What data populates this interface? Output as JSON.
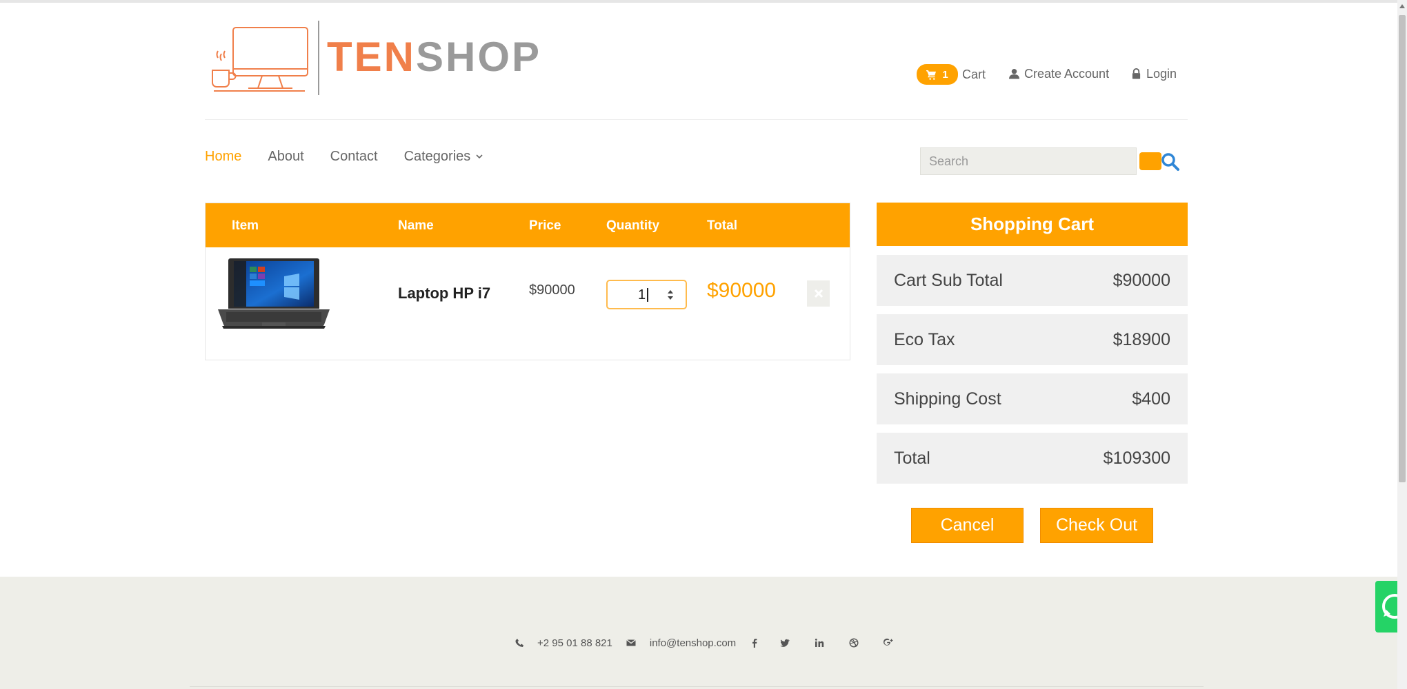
{
  "brand": {
    "part1": "TEN",
    "part2": "SHOP"
  },
  "header": {
    "cart_count": "1",
    "cart_label": "Cart",
    "create_account_label": "Create Account",
    "login_label": "Login"
  },
  "nav": {
    "items": [
      {
        "label": "Home",
        "active": true
      },
      {
        "label": "About",
        "active": false
      },
      {
        "label": "Contact",
        "active": false
      },
      {
        "label": "Categories",
        "active": false
      }
    ]
  },
  "search": {
    "placeholder": "Search"
  },
  "cart_table": {
    "headers": [
      "Item",
      "Name",
      "Price",
      "Quantity",
      "Total"
    ],
    "rows": [
      {
        "name": "Laptop HP i7",
        "price": "$90000",
        "quantity": "1",
        "total": "$90000"
      }
    ]
  },
  "summary": {
    "title": "Shopping Cart",
    "rows": [
      {
        "label": "Cart Sub Total",
        "value": "$90000"
      },
      {
        "label": "Eco Tax",
        "value": "$18900"
      },
      {
        "label": "Shipping Cost",
        "value": "$400"
      },
      {
        "label": "Total",
        "value": "$109300"
      }
    ],
    "cancel_label": "Cancel",
    "checkout_label": "Check Out"
  },
  "footer": {
    "phone": "+2 95 01 88 821",
    "email": "info@tenshop.com",
    "social_icons": [
      "facebook-icon",
      "twitter-icon",
      "linkedin-icon",
      "dribbble-icon",
      "google-plus-icon"
    ]
  },
  "colors": {
    "accent": "#ffa200",
    "logo_orange": "#f07f4a",
    "logo_gray": "#9a9a9a",
    "footer_bg": "#eeeee8",
    "search_icon": "#2f86d6",
    "whatsapp": "#25d366"
  }
}
